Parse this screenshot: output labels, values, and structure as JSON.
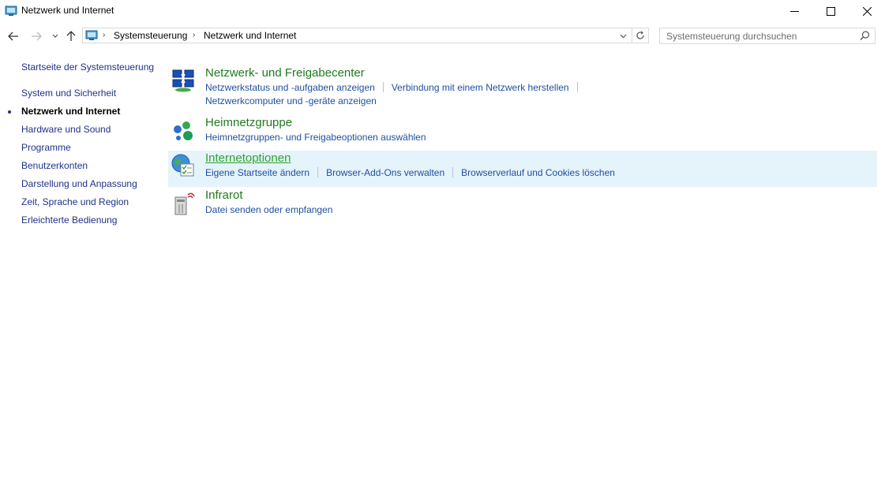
{
  "window": {
    "title": "Netzwerk und Internet"
  },
  "address": {
    "crumbs": [
      "Systemsteuerung",
      "Netzwerk und Internet"
    ]
  },
  "search": {
    "placeholder": "Systemsteuerung durchsuchen"
  },
  "sidebar": {
    "items": [
      {
        "label": "Startseite der Systemsteuerung"
      },
      {
        "label": "System und Sicherheit"
      },
      {
        "label": "Netzwerk und Internet"
      },
      {
        "label": "Hardware und Sound"
      },
      {
        "label": "Programme"
      },
      {
        "label": "Benutzerkonten"
      },
      {
        "label": "Darstellung und Anpassung"
      },
      {
        "label": "Zeit, Sprache und Region"
      },
      {
        "label": "Erleichterte Bedienung"
      }
    ],
    "active_index": 2
  },
  "categories": [
    {
      "title": "Netzwerk- und Freigabecenter",
      "icon": "network-sharing-center-icon",
      "links": [
        "Netzwerkstatus und -aufgaben anzeigen",
        "Verbindung mit einem Netzwerk herstellen",
        "Netzwerkcomputer und -geräte anzeigen"
      ]
    },
    {
      "title": "Heimnetzgruppe",
      "icon": "homegroup-icon",
      "links": [
        "Heimnetzgruppen- und Freigabeoptionen auswählen"
      ]
    },
    {
      "title": "Internetoptionen",
      "icon": "internet-options-icon",
      "links": [
        "Eigene Startseite ändern",
        "Browser-Add-Ons verwalten",
        "Browserverlauf und Cookies löschen"
      ],
      "hovered": true
    },
    {
      "title": "Infrarot",
      "icon": "infrared-icon",
      "links": [
        "Datei senden oder empfangen"
      ]
    }
  ],
  "colors": {
    "link": "#1e50a0",
    "heading": "#1e7b1e",
    "hover_bg": "#e5f3fb"
  }
}
